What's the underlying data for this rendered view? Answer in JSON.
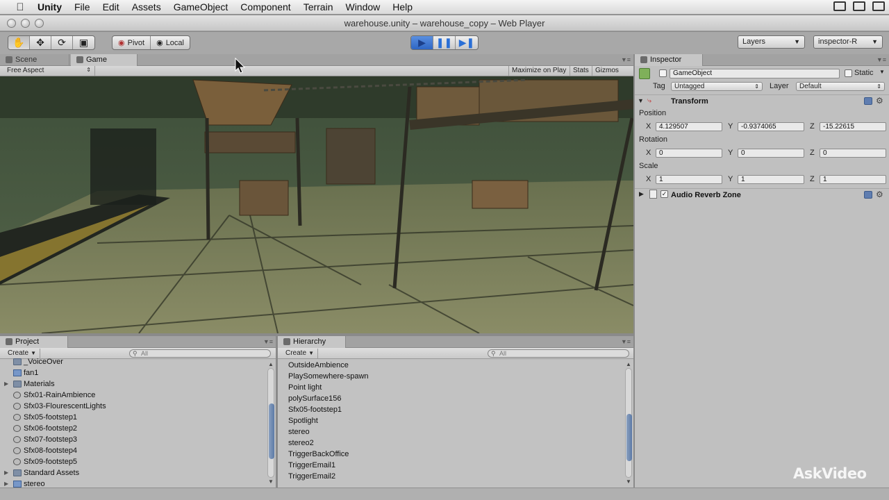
{
  "menubar": {
    "app": "Unity",
    "items": [
      "File",
      "Edit",
      "Assets",
      "GameObject",
      "Component",
      "Terrain",
      "Window",
      "Help"
    ]
  },
  "window": {
    "title": "warehouse.unity – warehouse_copy – Web Player"
  },
  "toolbar": {
    "tools": [
      "hand-icon",
      "move-icon",
      "rotate-icon",
      "scale-icon"
    ],
    "pivot_label": "Pivot",
    "local_label": "Local",
    "play_controls": [
      "play-icon",
      "pause-icon",
      "step-icon"
    ],
    "layers_label": "Layers",
    "layout_label": "inspector-R"
  },
  "scene_tabs": {
    "scene": "Scene",
    "game": "Game"
  },
  "game_bar": {
    "aspect": "Free Aspect",
    "maximize": "Maximize on Play",
    "stats": "Stats",
    "gizmos": "Gizmos"
  },
  "project": {
    "tab": "Project",
    "create": "Create",
    "search_placeholder": "All",
    "items": [
      {
        "label": "_VoiceOver",
        "type": "folder",
        "fold": false
      },
      {
        "label": "fan1",
        "type": "prefab",
        "fold": false
      },
      {
        "label": "Materials",
        "type": "folder",
        "fold": true
      },
      {
        "label": "Sfx01-RainAmbience",
        "type": "audio",
        "fold": false
      },
      {
        "label": "Sfx03-FlourescentLights",
        "type": "audio",
        "fold": false
      },
      {
        "label": "Sfx05-footstep1",
        "type": "audio",
        "fold": false
      },
      {
        "label": "Sfx06-footstep2",
        "type": "audio",
        "fold": false
      },
      {
        "label": "Sfx07-footstep3",
        "type": "audio",
        "fold": false
      },
      {
        "label": "Sfx08-footstep4",
        "type": "audio",
        "fold": false
      },
      {
        "label": "Sfx09-footstep5",
        "type": "audio",
        "fold": false
      },
      {
        "label": "Standard Assets",
        "type": "folder",
        "fold": true
      },
      {
        "label": "stereo",
        "type": "prefab",
        "fold": true
      }
    ]
  },
  "hierarchy": {
    "tab": "Hierarchy",
    "create": "Create",
    "search_placeholder": "All",
    "items": [
      "OutsideAmbience",
      "PlaySomewhere-spawn",
      "Point light",
      "polySurface156",
      "Sfx05-footstep1",
      "Spotlight",
      "stereo",
      "stereo2",
      "TriggerBackOffice",
      "TriggerEmail1",
      "TriggerEmail2"
    ]
  },
  "inspector": {
    "tab": "Inspector",
    "object_name": "GameObject",
    "static_label": "Static",
    "tag_label": "Tag",
    "tag_value": "Untagged",
    "layer_label": "Layer",
    "layer_value": "Default",
    "transform": {
      "title": "Transform",
      "position_label": "Position",
      "rotation_label": "Rotation",
      "scale_label": "Scale",
      "axis": {
        "x": "X",
        "y": "Y",
        "z": "Z"
      },
      "position": {
        "x": "4.129507",
        "y": "-0.9374065",
        "z": "-15.22615"
      },
      "rotation": {
        "x": "0",
        "y": "0",
        "z": "0"
      },
      "scale": {
        "x": "1",
        "y": "1",
        "z": "1"
      }
    },
    "audio_reverb": {
      "title": "Audio Reverb Zone",
      "enabled": true
    }
  },
  "watermark": "AskVideo"
}
